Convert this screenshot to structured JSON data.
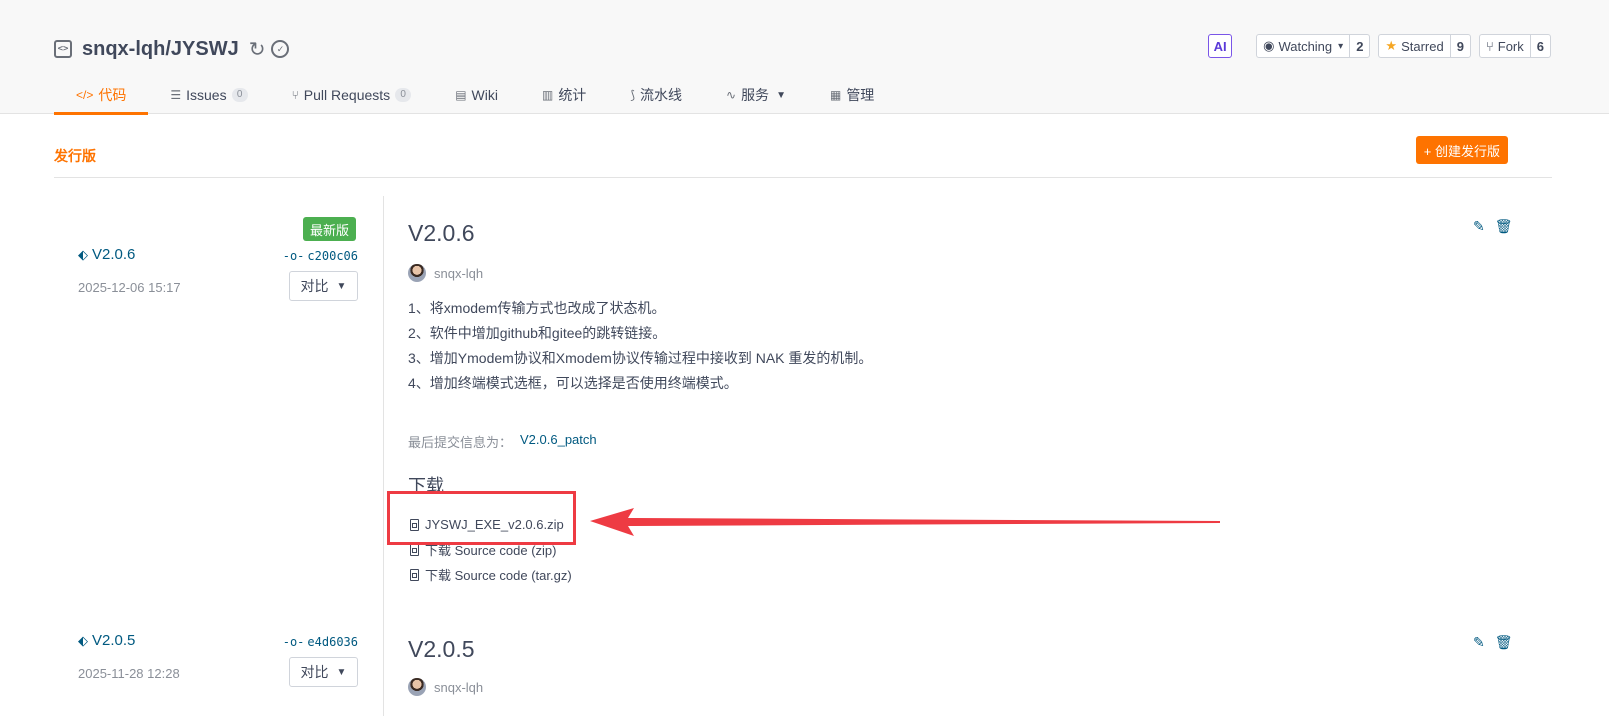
{
  "repo": {
    "name": "snqx-lqh/JYSWJ"
  },
  "actions": {
    "ai_label": "AI",
    "watching": {
      "label": "Watching",
      "count": "2"
    },
    "starred": {
      "label": "Starred",
      "count": "9"
    },
    "fork": {
      "label": "Fork",
      "count": "6"
    }
  },
  "tabs": [
    {
      "label": "代码",
      "icon": "</>"
    },
    {
      "label": "Issues",
      "icon": "☰",
      "count": "0"
    },
    {
      "label": "Pull Requests",
      "icon": "⑂",
      "count": "0"
    },
    {
      "label": "Wiki",
      "icon": "▤"
    },
    {
      "label": "统计",
      "icon": "▥"
    },
    {
      "label": "流水线",
      "icon": "⟆"
    },
    {
      "label": "服务",
      "icon": "∿"
    },
    {
      "label": "管理",
      "icon": "▦"
    }
  ],
  "section": {
    "title": "发行版",
    "create_label": "+ 创建发行版"
  },
  "releases": [
    {
      "tag": "V2.0.6",
      "commit": "c200c06",
      "date": "2025-12-06 15:17",
      "latest_label": "最新版",
      "compare_label": "对比",
      "title": "V2.0.6",
      "author": "snqx-lqh",
      "notes": [
        "1、将xmodem传输方式也改成了状态机。",
        "2、软件中增加github和gitee的跳转链接。",
        "3、增加Ymodem协议和Xmodem协议传输过程中接收到 NAK 重发的机制。",
        "4、增加终端模式选框，可以选择是否使用终端模式。"
      ],
      "last_commit_label": "最后提交信息为：",
      "last_commit_value": "V2.0.6_patch",
      "download_title": "下载",
      "downloads": [
        "JYSWJ_EXE_v2.0.6.zip",
        "下载 Source code (zip)",
        "下载 Source code (tar.gz)"
      ]
    },
    {
      "tag": "V2.0.5",
      "commit": "e4d6036",
      "date": "2025-11-28 12:28",
      "compare_label": "对比",
      "title": "V2.0.5",
      "author": "snqx-lqh"
    }
  ],
  "colors": {
    "accent": "#fe7300",
    "link": "#005980",
    "latest": "#4caf50",
    "annotation": "#ee3b43"
  }
}
